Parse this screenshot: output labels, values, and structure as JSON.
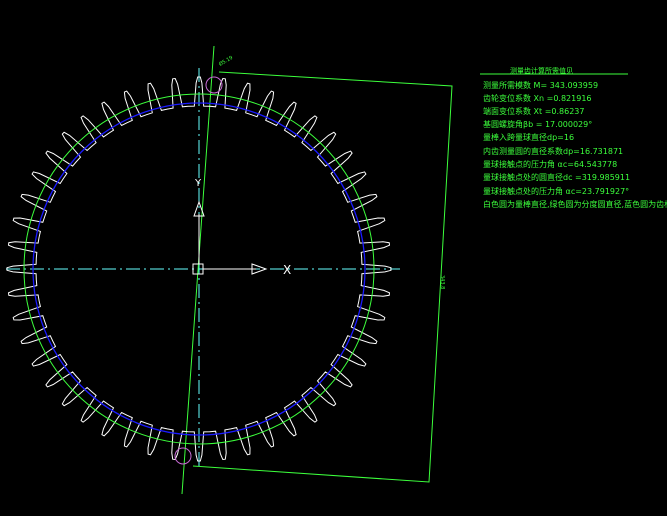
{
  "colors": {
    "background": "#000000",
    "gear_teeth": "#ffffff",
    "root_circle": "#1a1aff",
    "addendum_circle": "#3cff3c",
    "centerline": "#66ffff",
    "annotation": "#3cff3c",
    "marker": "#c86bd6"
  },
  "gear": {
    "tooth_count": 48
  },
  "notes": {
    "title": "测量齿计算所需值见",
    "lines": [
      "测量所需模数 M= 343.093959",
      "齿轮变位系数 Xn =0.821916",
      "端面变位系数 Xt =0.86237",
      "基圆螺旋角βb = 17.000029°",
      "量棒入跨量球直径dp=16",
      "内齿测量圆的直径系数dp=16.731871",
      "量球接触点的压力角 αc=64.543778",
      "量球接触点处的圆直径dc =319.985911",
      "量球接触点处的压力角 αc=23.791927°",
      "白色圆为量棒直径,绿色圆为分度圆直径,蓝色圆为齿根圆直径"
    ]
  },
  "dimension": {
    "top_label": "Ø5.19",
    "side_label": "343.8"
  },
  "axis_labels": {
    "y": "Y",
    "x": "X"
  }
}
